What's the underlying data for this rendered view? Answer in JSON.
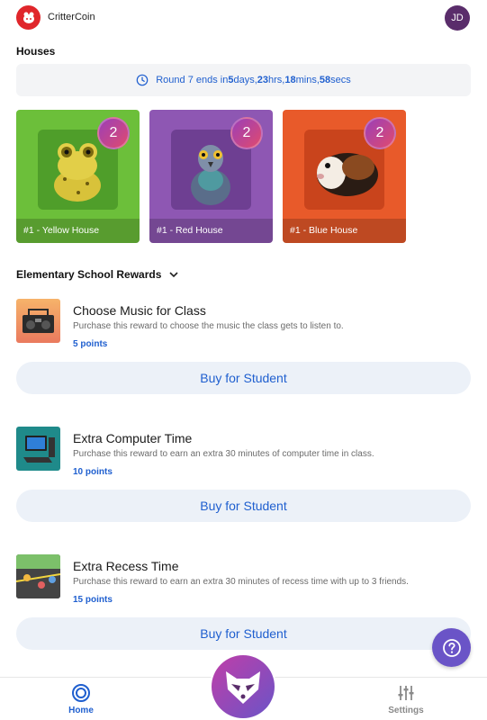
{
  "app": {
    "title": "CritterCoin",
    "avatar_initials": "JD",
    "logo_icon": "critter-logo-icon",
    "brand_color": "#e0262b"
  },
  "houses_section": {
    "title": "Houses",
    "round": {
      "prefix": "Round 7 ends in ",
      "days_value": "5",
      "days_unit": " days, ",
      "hrs_value": "23",
      "hrs_unit": " hrs, ",
      "mins_value": "18",
      "mins_unit": " mins, ",
      "secs_value": "58",
      "secs_unit": " secs"
    },
    "houses": [
      {
        "label": "#1 - Yellow House",
        "count": "2",
        "color": "#6cbf3a",
        "art": "frog"
      },
      {
        "label": "#1 - Red House",
        "count": "2",
        "color": "#8e57b3",
        "art": "pigeon"
      },
      {
        "label": "#1 - Blue House",
        "count": "2",
        "color": "#e85a2a",
        "art": "guinea-pig"
      }
    ]
  },
  "rewards_section": {
    "title": "Elementary School Rewards",
    "rewards": [
      {
        "title": "Choose Music for Class",
        "description": "Purchase this reward to choose the music the class gets to listen to.",
        "points": "5 points",
        "button": "Buy for Student",
        "icon": "boombox-icon"
      },
      {
        "title": "Extra Computer Time",
        "description": "Purchase this reward to earn an extra 30 minutes of computer time in class.",
        "points": "10 points",
        "button": "Buy for Student",
        "icon": "computer-icon"
      },
      {
        "title": "Extra Recess Time",
        "description": "Purchase this reward to earn an extra 30 minutes of recess time with up to 3 friends.",
        "points": "15 points",
        "button": "Buy for Student",
        "icon": "playground-icon"
      }
    ]
  },
  "bottom_nav": {
    "home_label": "Home",
    "settings_label": "Settings"
  },
  "colors": {
    "accent": "#1f5fcf",
    "fab": "#6a54c7"
  }
}
